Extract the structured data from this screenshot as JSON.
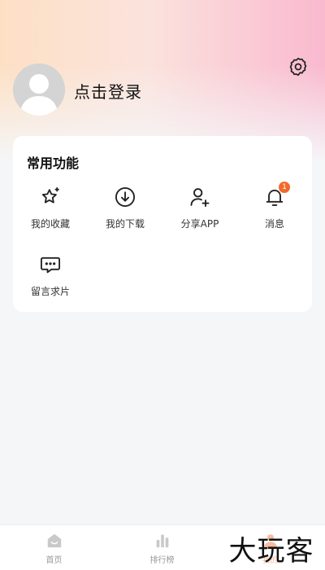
{
  "profile": {
    "login_label": "点击登录"
  },
  "icons": {
    "settings": "gear-icon",
    "avatar": "user-avatar-icon"
  },
  "common_functions": {
    "title": "常用功能",
    "items": [
      {
        "label": "我的收藏",
        "icon": "star-sparkle-icon"
      },
      {
        "label": "我的下载",
        "icon": "download-icon"
      },
      {
        "label": "分享APP",
        "icon": "add-user-icon"
      },
      {
        "label": "消息",
        "icon": "bell-icon",
        "badge": "1"
      },
      {
        "label": "留言求片",
        "icon": "chat-bubble-icon"
      }
    ]
  },
  "tabbar": {
    "items": [
      {
        "label": "首页",
        "icon": "home-icon",
        "active": false
      },
      {
        "label": "排行榜",
        "icon": "bar-chart-icon",
        "active": false
      },
      {
        "label": "我的",
        "icon": "profile-icon",
        "active": true
      }
    ]
  },
  "watermark": {
    "text": "大玩客"
  },
  "colors": {
    "accent": "#f26a2b",
    "gradient_left": "#fde0c4",
    "gradient_right": "#f9b9cf",
    "background": "#f5f6f8"
  }
}
